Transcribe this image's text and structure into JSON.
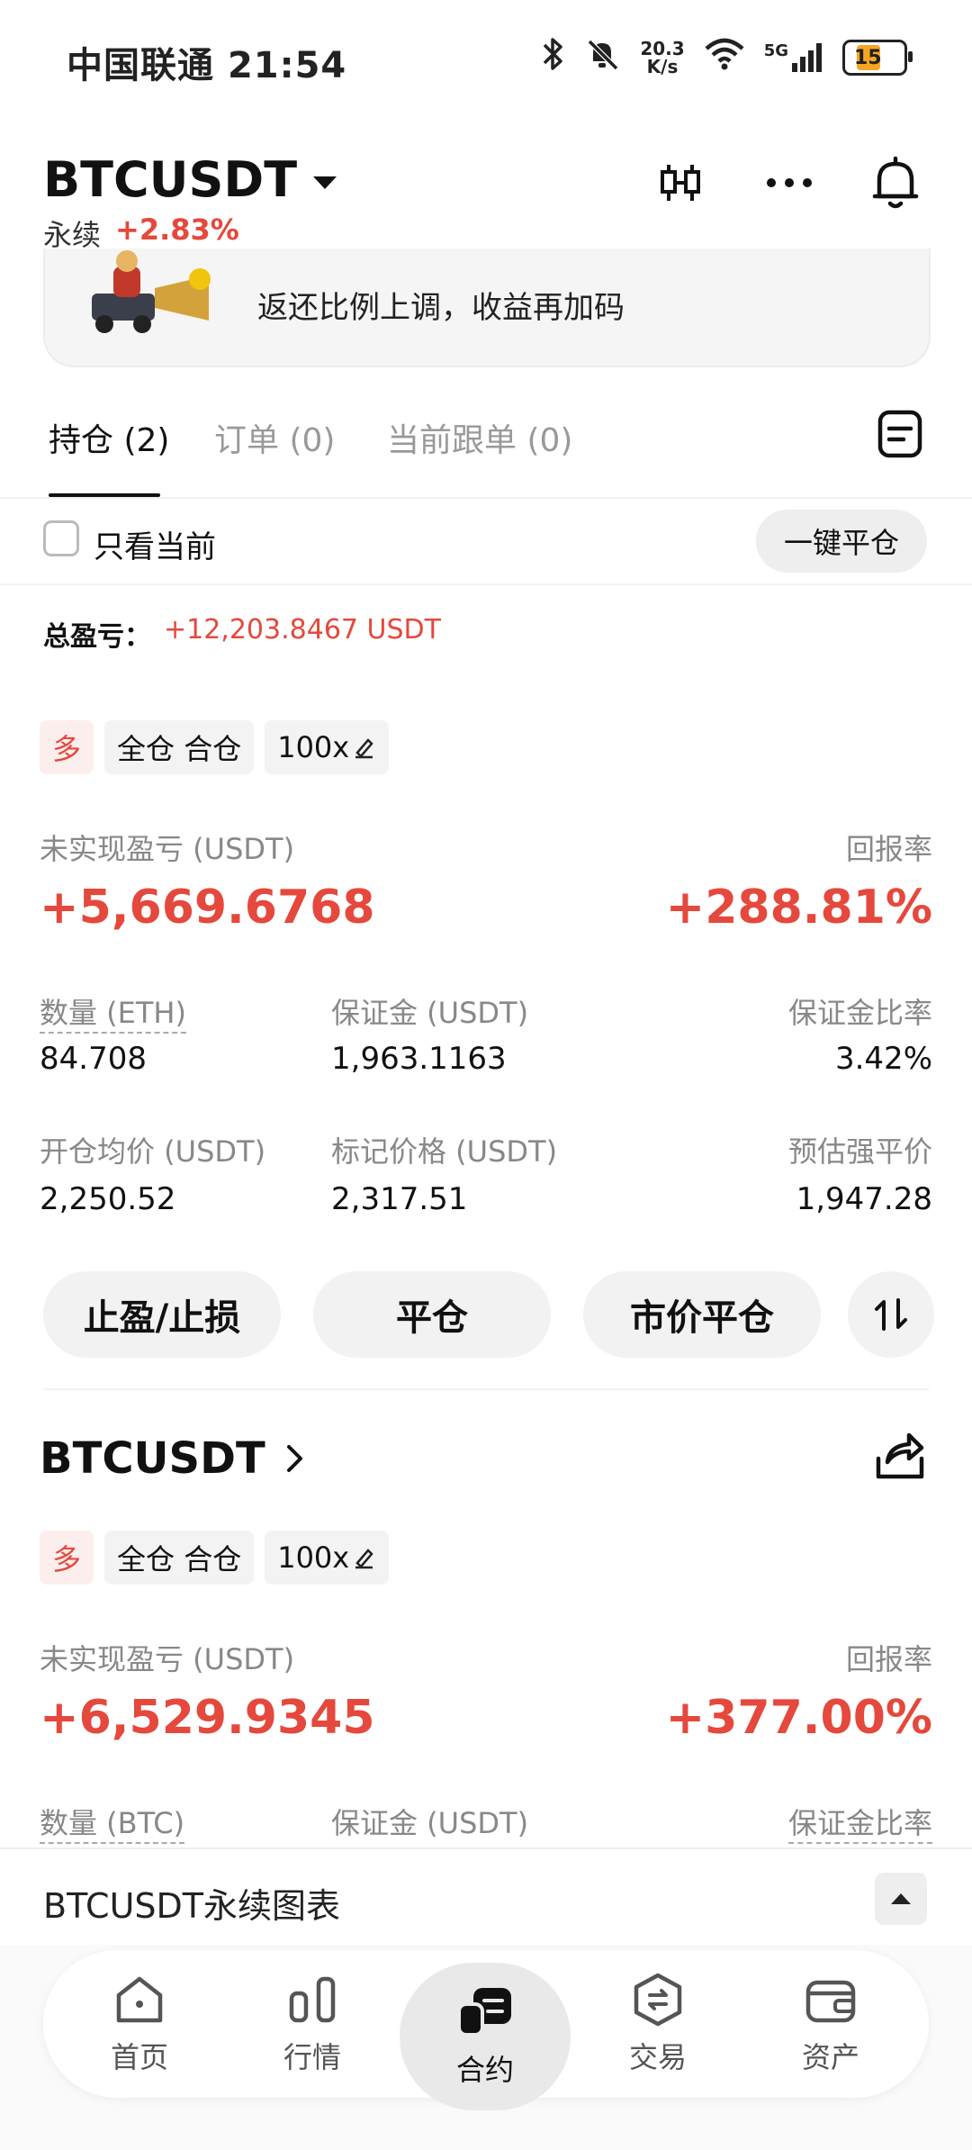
{
  "status_bar": {
    "carrier": "中国联通",
    "time": "21:54",
    "net_speed_value": "20.3",
    "net_speed_unit": "K/s",
    "signal_label": "5G",
    "battery": "15"
  },
  "header": {
    "pair": "BTCUSDT",
    "contract_type": "永续",
    "change": "+2.83%"
  },
  "banner": {
    "text": "返还比例上调，收益再加码"
  },
  "tabs": [
    {
      "label": "持仓 (2)"
    },
    {
      "label": "订单 (0)"
    },
    {
      "label": "当前跟单 (0)"
    }
  ],
  "filter": {
    "only_current_label": "只看当前",
    "close_all_label": "一键平仓"
  },
  "summary": {
    "total_pnl_label": "总盈亏：",
    "total_pnl_value": "+12,203.8467 USDT"
  },
  "positions": [
    {
      "tags": {
        "side": "多",
        "mode": "全仓 合仓",
        "leverage": "100x"
      },
      "unrealized_label": "未实现盈亏 (USDT)",
      "unrealized_value": "+5,669.6768",
      "roe_label": "回报率",
      "roe_value": "+288.81%",
      "qty_label": "数量 (ETH)",
      "qty_value": "84.708",
      "margin_label": "保证金 (USDT)",
      "margin_value": "1,963.1163",
      "margin_ratio_label": "保证金比率",
      "margin_ratio_value": "3.42%",
      "entry_label": "开仓均价 (USDT)",
      "entry_value": "2,250.52",
      "mark_label": "标记价格 (USDT)",
      "mark_value": "2,317.51",
      "liq_label": "预估强平价",
      "liq_value": "1,947.28",
      "buttons": {
        "tpsl": "止盈/止损",
        "close": "平仓",
        "market_close": "市价平仓"
      }
    },
    {
      "symbol": "BTCUSDT",
      "tags": {
        "side": "多",
        "mode": "全仓 合仓",
        "leverage": "100x"
      },
      "unrealized_label": "未实现盈亏 (USDT)",
      "unrealized_value": "+6,529.9345",
      "roe_label": "回报率",
      "roe_value": "+377.00%",
      "qty_label": "数量 (BTC)",
      "margin_label": "保证金 (USDT)",
      "margin_ratio_label": "保证金比率"
    }
  ],
  "chart_bar": {
    "title": "BTCUSDT永续图表"
  },
  "bottom_nav": [
    {
      "label": "首页",
      "icon": "home-icon"
    },
    {
      "label": "行情",
      "icon": "market-icon"
    },
    {
      "label": "合约",
      "icon": "futures-icon",
      "active": true
    },
    {
      "label": "交易",
      "icon": "trade-icon"
    },
    {
      "label": "资产",
      "icon": "wallet-icon"
    }
  ],
  "colors": {
    "up_red": "#e5483c",
    "battery_orange": "#f5a623"
  }
}
